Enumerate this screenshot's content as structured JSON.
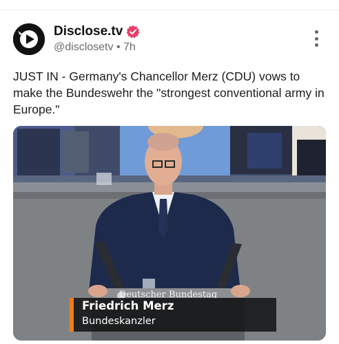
{
  "post": {
    "author_name": "Disclose.tv",
    "handle": "@disclosetv",
    "separator": "•",
    "time": "7h",
    "text": "JUST IN - Germany's Chancellor Merz (CDU) vows to make the Bundeswehr the \"strongest conventional army in Europe.\""
  },
  "icons": {
    "avatar": "play-logo-icon",
    "verified": "verified-badge-icon",
    "more": "more-options-icon"
  },
  "media": {
    "lectern_label": "Deutscher Bundestag",
    "caption_name": "Friedrich Merz",
    "caption_role": "Bundeskanzler"
  },
  "colors": {
    "verified_badge": "#e83e6a",
    "caption_accent": "#f07d1a"
  }
}
